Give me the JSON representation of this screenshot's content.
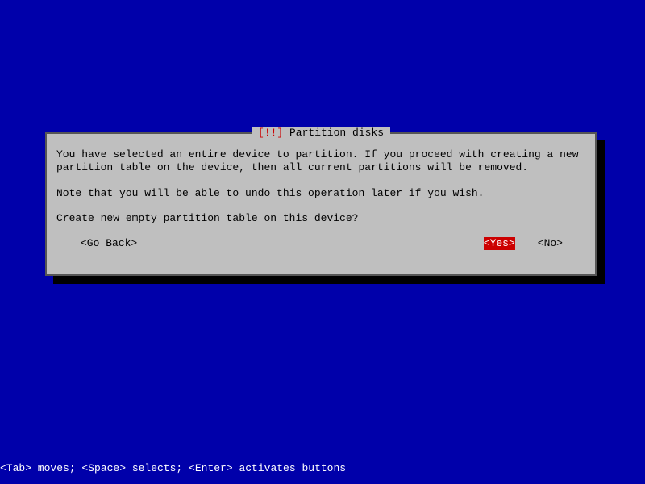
{
  "dialog": {
    "title_prefix": "[!!]",
    "title_text": "Partition disks",
    "body": {
      "para1": "You have selected an entire device to partition. If you proceed with creating a new partition table on the device, then all current partitions will be removed.",
      "para2": "Note that you will be able to undo this operation later if you wish.",
      "question": "Create new empty partition table on this device?"
    },
    "buttons": {
      "go_back": "<Go Back>",
      "yes": "<Yes>",
      "no": "<No>"
    }
  },
  "help_bar": "<Tab> moves; <Space> selects; <Enter> activates buttons"
}
